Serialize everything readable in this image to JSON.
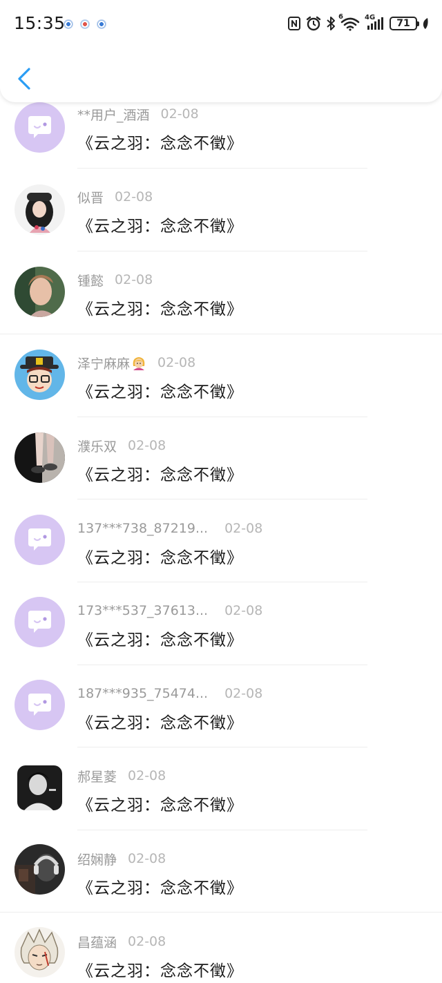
{
  "status_bar": {
    "time": "15:35",
    "network": "4G",
    "wifi_label": "6",
    "battery": "71"
  },
  "header": {
    "back_icon": "chevron-left-icon",
    "accent_color": "#2a9df4"
  },
  "list": {
    "items": [
      {
        "name": "**用户_酒酒",
        "date": "02-08",
        "message": "《云之羽：念念不徵》",
        "avatar": "default-chat"
      },
      {
        "name": "似晋",
        "date": "02-08",
        "message": "《云之羽：念念不徵》",
        "avatar": "photo-girl-hat"
      },
      {
        "name": "锺懿",
        "date": "02-08",
        "message": "《云之羽：念念不徵》",
        "avatar": "photo-woman-portrait"
      },
      {
        "name": "泽宁麻麻",
        "date": "02-08",
        "message": "《云之羽：念念不徵》",
        "avatar": "cartoon-hat-glasses"
      },
      {
        "name": "濮乐双",
        "date": "02-08",
        "message": "《云之羽：念念不徵》",
        "avatar": "photo-legs"
      },
      {
        "name": "137***738_87219...",
        "date": "02-08",
        "message": "《云之羽：念念不徵》",
        "avatar": "default-chat"
      },
      {
        "name": "173***537_37613...",
        "date": "02-08",
        "message": "《云之羽：念念不徵》",
        "avatar": "default-chat"
      },
      {
        "name": "187***935_75474...",
        "date": "02-08",
        "message": "《云之羽：念念不徵》",
        "avatar": "default-chat"
      },
      {
        "name": "郝星菱",
        "date": "02-08",
        "message": "《云之羽：念念不徵》",
        "avatar": "photo-bw-man"
      },
      {
        "name": "绍娴静",
        "date": "02-08",
        "message": "《云之羽：念念不徵》",
        "avatar": "photo-dark-headphones"
      },
      {
        "name": "昌蕴涵",
        "date": "02-08",
        "message": "《云之羽：念念不徵》",
        "avatar": "anime-white-hair"
      }
    ]
  },
  "colors": {
    "default_avatar_bg": "#d7c6f3",
    "name_text": "#9a9a9a",
    "message_text": "#1c1c1c"
  }
}
